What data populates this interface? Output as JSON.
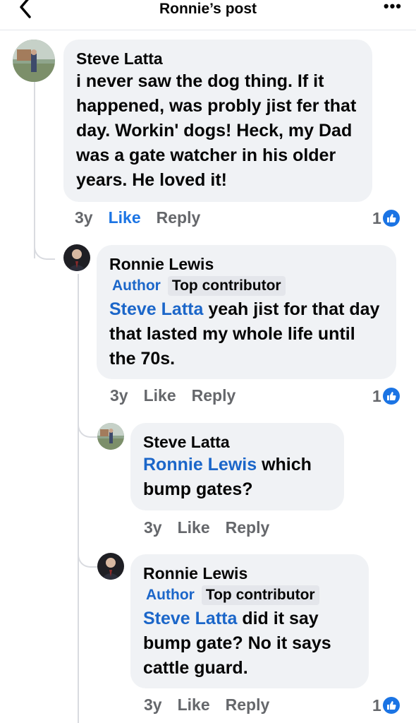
{
  "header": {
    "title": "Ronnie’s post",
    "more": "•••"
  },
  "comments": [
    {
      "author": "Steve Latta",
      "text": "i never saw the dog thing. If it happened, was probly jist fer that day. Workin' dogs! Heck, my Dad was a gate watcher in his older years. He loved it!",
      "time": "3y",
      "like": "Like",
      "reply": "Reply",
      "reactions": "1"
    },
    {
      "author": "Ronnie Lewis",
      "badges": [
        "Author",
        "Top contributor"
      ],
      "mention": "Steve Latta",
      "text": " yeah jist for that day that lasted my whole life until the 70s.",
      "time": "3y",
      "like": "Like",
      "reply": "Reply",
      "reactions": "1"
    },
    {
      "author": "Steve Latta",
      "mention": "Ronnie Lewis",
      "text": " which bump gates?",
      "time": "3y",
      "like": "Like",
      "reply": "Reply"
    },
    {
      "author": "Ronnie Lewis",
      "badges": [
        "Author",
        "Top contributor"
      ],
      "mention": "Steve Latta",
      "text": " did it say bump gate? No it says cattle guard.",
      "time": "3y",
      "like": "Like",
      "reply": "Reply",
      "reactions": "1"
    }
  ],
  "colors": {
    "accent": "#1b74e4",
    "mention": "#1b66c9",
    "bubble": "#f0f2f5",
    "meta": "#65676b"
  }
}
